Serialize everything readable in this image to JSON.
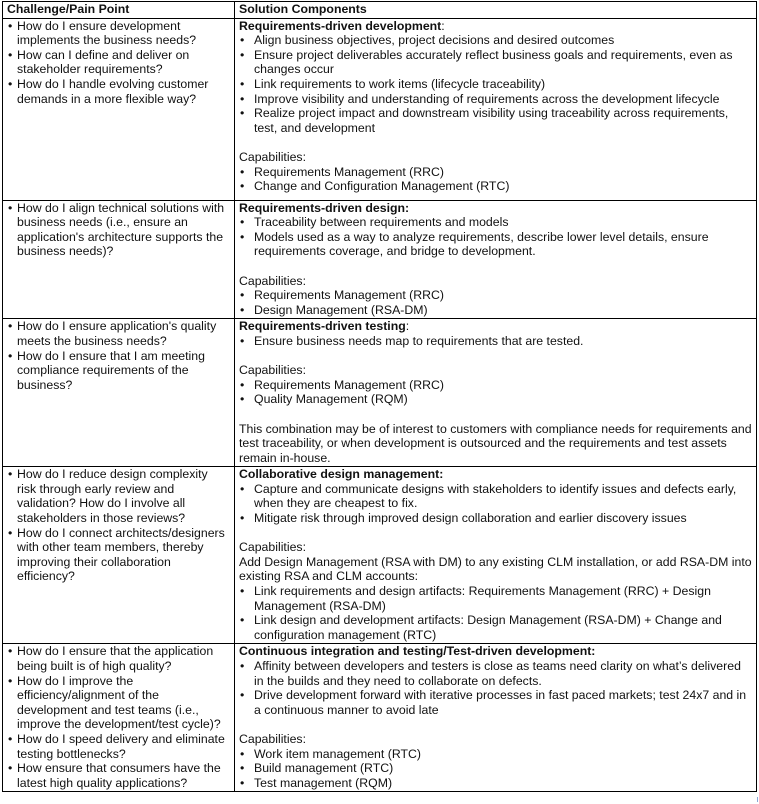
{
  "table": {
    "headers": [
      "Challenge/Pain Point",
      "Solution Components"
    ],
    "rows": [
      {
        "challenges": [
          "How do I ensure development implements the business needs?",
          "How can I define and deliver on stakeholder requirements?",
          "How do I handle evolving customer demands in a more flexible way?"
        ],
        "solution_title": "Requirements-driven development",
        "solution_title_suffix": ":",
        "solution_points": [
          "Align business objectives, project decisions and desired outcomes",
          "Ensure project deliverables accurately reflect business goals and requirements, even as changes occur",
          "Link requirements to work items (lifecycle traceability)",
          "Improve visibility and understanding of requirements across the development lifecycle",
          "Realize project impact and downstream visibility using traceability across requirements, test, and development"
        ],
        "capabilities_label": "Capabilities:",
        "capabilities": [
          "Requirements Management (RRC)",
          "Change and Configuration Management (RTC)"
        ]
      },
      {
        "challenges": [
          "How do I align technical solutions with business needs (i.e., ensure an application's architecture supports the business needs)?"
        ],
        "solution_title": "Requirements-driven design:",
        "solution_points": [
          "Traceability between requirements and models",
          "Models used as a way to analyze requirements, describe lower level details, ensure requirements coverage, and bridge to development."
        ],
        "capabilities_label": "Capabilities:",
        "capabilities": [
          "Requirements Management (RRC)",
          "Design Management (RSA-DM)"
        ]
      },
      {
        "challenges": [
          "How do I ensure application's quality meets the business needs?",
          "How do I ensure that I am meeting compliance requirements of the business?"
        ],
        "solution_title": "Requirements-driven testing",
        "solution_title_suffix": ":",
        "solution_points": [
          "Ensure business needs map to requirements that are tested."
        ],
        "capabilities_label": "Capabilities:",
        "capabilities": [
          "Requirements Management (RRC)",
          "Quality Management (RQM)"
        ],
        "note": "This combination may be of interest to customers with compliance needs for requirements and test traceability, or when development is outsourced and the requirements and test assets remain in-house."
      },
      {
        "challenges": [
          "How do I reduce design complexity risk through early review and validation? How do I involve all stakeholders in those reviews?",
          "How do I connect architects/designers with other team members, thereby improving their collaboration efficiency?"
        ],
        "solution_title": "Collaborative design management:",
        "solution_points": [
          "Capture and communicate designs with stakeholders to identify issues and defects early, when they are cheapest to fix.",
          "Mitigate risk through improved design collaboration and earlier discovery issues"
        ],
        "capabilities_label": "Capabilities:",
        "capabilities_intro": "Add Design Management (RSA with DM) to any existing CLM installation, or add RSA-DM into existing RSA and CLM accounts:",
        "capabilities": [
          "Link requirements and design artifacts: Requirements Management (RRC) + Design Management (RSA-DM)",
          "Link design and development artifacts: Design Management (RSA-DM) + Change and configuration management (RTC)"
        ]
      },
      {
        "challenges": [
          "How do I ensure that the application being built is of high quality?",
          "How do I improve the efficiency/alignment of the development and test teams (i.e., improve the development/test cycle)?",
          "How do I speed delivery and eliminate testing bottlenecks?",
          "How ensure that consumers have the latest high quality applications?"
        ],
        "solution_title": "Continuous integration and testing/Test-driven development:",
        "solution_points": [
          "Affinity between developers and testers is close as teams need clarity on what’s delivered in the builds and they need to collaborate on defects.",
          "Drive development forward with iterative processes in fast paced markets; test 24x7 and in a continuous manner to avoid late"
        ],
        "capabilities_label": "Capabilities:",
        "capabilities": [
          "Work item management (RTC)",
          "Build management (RTC)",
          "Test management (RQM)"
        ]
      }
    ]
  }
}
